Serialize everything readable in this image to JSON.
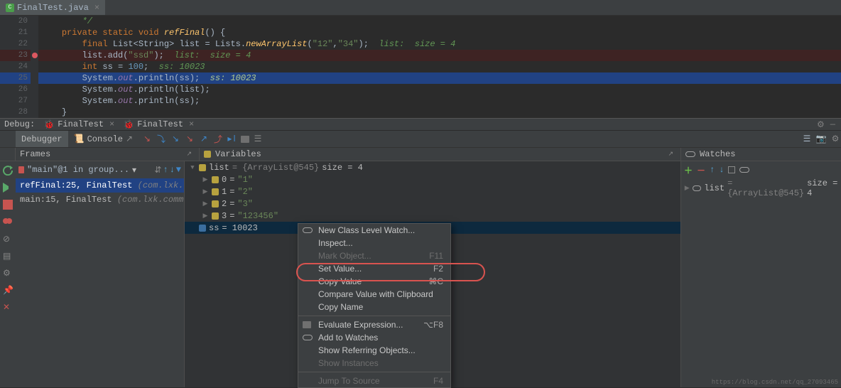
{
  "tab": {
    "filename": "FinalTest.java"
  },
  "editor": {
    "lines": [
      {
        "n": 20,
        "html": "        <span class='c'>*/</span>"
      },
      {
        "n": 21,
        "html": "    <span class='k'>private static void </span><span class='m'>refFinal</span><span class='t'>() {</span>"
      },
      {
        "n": 22,
        "html": "        <span class='k'>final </span><span class='t'>List&lt;String&gt; list = Lists.</span><span class='m'>newArrayList</span><span class='t'>(</span><span class='s'>\"12\"</span><span class='t'>,</span><span class='s'>\"34\"</span><span class='t'>);  </span><span class='c'>list:  size = 4</span>"
      },
      {
        "n": 23,
        "html": "        <span class='t'>list.add(</span><span class='s'>\"ssd\"</span><span class='t'>);  </span><span class='c'>list:  size = 4</span>",
        "bp": true
      },
      {
        "n": 24,
        "html": "        <span class='k'>int </span><span class='t'>ss = </span><span class='n'>100</span><span class='t'>;  </span><span class='c'>ss: 10023</span>"
      },
      {
        "n": 25,
        "html": "        <span class='t'>System.</span><span class='id' style='font-style:italic;color:#9876aa'>out</span><span class='t'>.println(ss);  </span><span class='c' style='color:#b0c98f'>ss: 10023</span>",
        "exec": true
      },
      {
        "n": 26,
        "html": "        <span class='t'>System.</span><span class='id' style='font-style:italic;color:#9876aa'>out</span><span class='t'>.println(list);</span>"
      },
      {
        "n": 27,
        "html": "        <span class='t'>System.</span><span class='id' style='font-style:italic;color:#9876aa'>out</span><span class='t'>.println(ss);</span>"
      },
      {
        "n": 28,
        "html": "    <span class='t'>}</span>"
      }
    ]
  },
  "debugBar": {
    "label": "Debug:",
    "tabs": [
      "FinalTest",
      "FinalTest"
    ]
  },
  "subBar": {
    "debugger": "Debugger",
    "console": "Console"
  },
  "panelsHeader": {
    "frames": "Frames",
    "variables": "Variables",
    "watches": "Watches"
  },
  "thread": "\"main\"@1 in group...",
  "frames": [
    {
      "main": "refFinal:25, FinalTest",
      "dim": "(com.lxk.commonTe",
      "selected": true
    },
    {
      "main": "main:15, FinalTest",
      "dim": "(com.lxk.commonTest)",
      "selected": false
    }
  ],
  "vars": {
    "listLabel": "list",
    "listObj": "= {ArrayList@545}",
    "listSize": "  size = 4",
    "items": [
      {
        "k": "0",
        "v": "\"1\""
      },
      {
        "k": "1",
        "v": "\"2\""
      },
      {
        "k": "2",
        "v": "\"3\""
      },
      {
        "k": "3",
        "v": "\"123456\""
      }
    ],
    "ssLabel": "ss",
    "ssVal": "= 10023"
  },
  "watch": {
    "listLabel": "list",
    "listObj": "= {ArrayList@545}",
    "listSize": "  size = 4"
  },
  "ctx": [
    {
      "label": "New Class Level Watch...",
      "icon": "glasses"
    },
    {
      "label": "Inspect..."
    },
    {
      "label": "Mark Object...",
      "short": "F11",
      "disabled": true
    },
    {
      "label": "Set Value...",
      "short": "F2"
    },
    {
      "label": "Copy Value",
      "short": "⌘C"
    },
    {
      "label": "Compare Value with Clipboard"
    },
    {
      "label": "Copy Name"
    },
    {
      "sep": true
    },
    {
      "label": "Evaluate Expression...",
      "short": "⌥F8",
      "icon": "calc"
    },
    {
      "label": "Add to Watches",
      "icon": "glasses"
    },
    {
      "label": "Show Referring Objects..."
    },
    {
      "label": "Show Instances",
      "disabled": true
    },
    {
      "sep": true
    },
    {
      "label": "Jump To Source",
      "short": "F4",
      "disabled": true
    }
  ],
  "watermark": "https://blog.csdn.net/qq_27093465"
}
